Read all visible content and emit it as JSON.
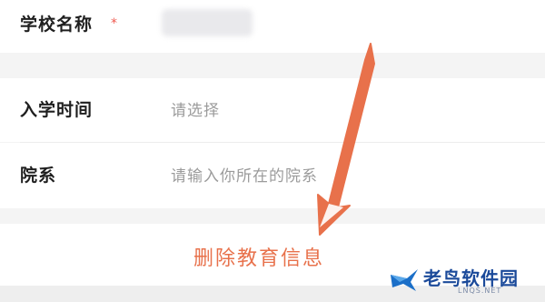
{
  "form": {
    "school_name": {
      "label": "学校名称",
      "required_mark": "*"
    },
    "enrollment_time": {
      "label": "入学时间",
      "placeholder": "请选择"
    },
    "department": {
      "label": "院系",
      "placeholder": "请输入你所在的院系"
    }
  },
  "annotation": {
    "delete_label": "删除教育信息",
    "arrow_color": "#e8714b"
  },
  "watermark": {
    "title": "老鸟软件园",
    "subtitle": "LNQS.NET",
    "color": "#1b4a9a"
  }
}
